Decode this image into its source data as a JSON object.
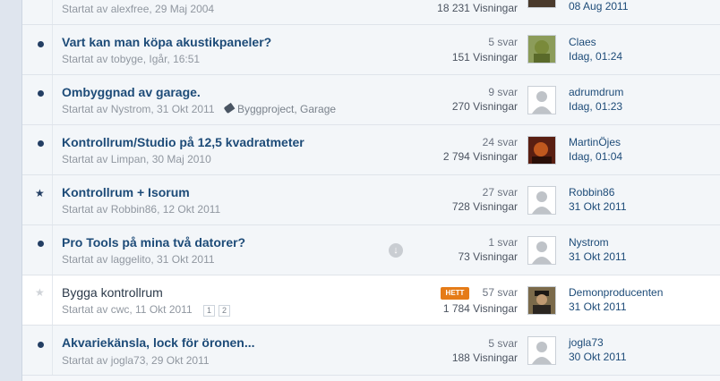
{
  "threads": [
    {
      "meta": "Startat av alexfree, 29 Maj 2004",
      "views": "18 231 Visningar",
      "last_date": "08 Aug 2011"
    },
    {
      "title": "Vart kan man köpa akustikpaneler?",
      "meta": "Startat av tobyge, Igår, 16:51",
      "replies": "5 svar",
      "views": "151 Visningar",
      "last_user": "Claes",
      "last_date": "Idag, 01:24"
    },
    {
      "title": "Ombyggnad av garage.",
      "meta": "Startat av Nystrom, 31 Okt 2011",
      "tags": "Byggproject, Garage",
      "replies": "9 svar",
      "views": "270 Visningar",
      "last_user": "adrumdrum",
      "last_date": "Idag, 01:23"
    },
    {
      "title": "Kontrollrum/Studio på 12,5 kvadratmeter",
      "meta": "Startat av Limpan, 30 Maj 2010",
      "replies": "24 svar",
      "views": "2 794 Visningar",
      "last_user": "MartinÖjes",
      "last_date": "Idag, 01:04"
    },
    {
      "title": "Kontrollrum + Isorum",
      "meta": "Startat av Robbin86, 12 Okt 2011",
      "replies": "27 svar",
      "views": "728 Visningar",
      "last_user": "Robbin86",
      "last_date": "31 Okt 2011"
    },
    {
      "title": "Pro Tools på mina två datorer?",
      "meta": "Startat av laggelito, 31 Okt 2011",
      "replies": "1 svar",
      "views": "73 Visningar",
      "last_user": "Nystrom",
      "last_date": "31 Okt 2011"
    },
    {
      "title": "Bygga kontrollrum",
      "meta": "Startat av cwc, 11 Okt 2011",
      "pages": [
        "1",
        "2"
      ],
      "badge": "HETT",
      "replies": "57 svar",
      "views": "1 784 Visningar",
      "last_user": "Demonproducenten",
      "last_date": "31 Okt 2011"
    },
    {
      "title": "Akvariekänsla, lock för öronen...",
      "meta": "Startat av jogla73, 29 Okt 2011",
      "replies": "5 svar",
      "views": "188 Visningar",
      "last_user": "jogla73",
      "last_date": "30 Okt 2011"
    }
  ]
}
